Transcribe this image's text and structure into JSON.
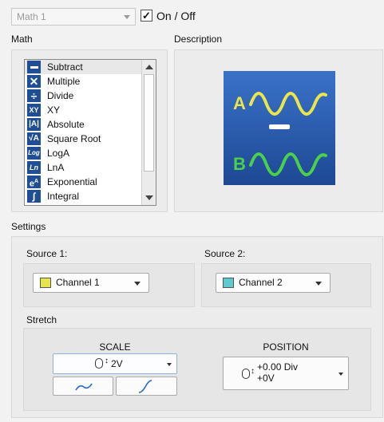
{
  "header": {
    "math_select_value": "Math 1",
    "onoff_checked": true,
    "onoff_check_glyph": "✓",
    "onoff_label": "On / Off"
  },
  "math": {
    "label": "Math",
    "items": [
      {
        "label": "Subtract",
        "icon": "minus-icon",
        "selected": true
      },
      {
        "label": "Multiple",
        "icon": "multiply-icon",
        "selected": false
      },
      {
        "label": "Divide",
        "icon": "divide-icon",
        "selected": false
      },
      {
        "label": "XY",
        "icon": "xy-icon",
        "selected": false
      },
      {
        "label": "Absolute",
        "icon": "absolute-icon",
        "selected": false
      },
      {
        "label": "Square Root",
        "icon": "square-root-icon",
        "selected": false
      },
      {
        "label": "LogA",
        "icon": "log-icon",
        "selected": false
      },
      {
        "label": "LnA",
        "icon": "ln-icon",
        "selected": false
      },
      {
        "label": "Exponential",
        "icon": "exponential-icon",
        "selected": false
      },
      {
        "label": "Integral",
        "icon": "integral-icon",
        "selected": false
      }
    ]
  },
  "description": {
    "label": "Description",
    "image_text_a": "A",
    "image_text_b": "B",
    "colors": {
      "bg": "#2a5fb4",
      "a": "#e8e64a",
      "b": "#4ccf4a"
    }
  },
  "settings": {
    "label": "Settings",
    "source1": {
      "label": "Source 1:",
      "value": "Channel 1",
      "color": "#e6e64a"
    },
    "source2": {
      "label": "Source 2:",
      "value": "Channel 2",
      "color": "#5ec9cf"
    }
  },
  "stretch": {
    "label": "Stretch",
    "scale": {
      "title": "SCALE",
      "value": "2V",
      "icon": "scale-knob-icon"
    },
    "position": {
      "title": "POSITION",
      "value_line1": "+0.00 Div",
      "value_line2": "+0V",
      "icon": "position-knob-icon"
    }
  }
}
